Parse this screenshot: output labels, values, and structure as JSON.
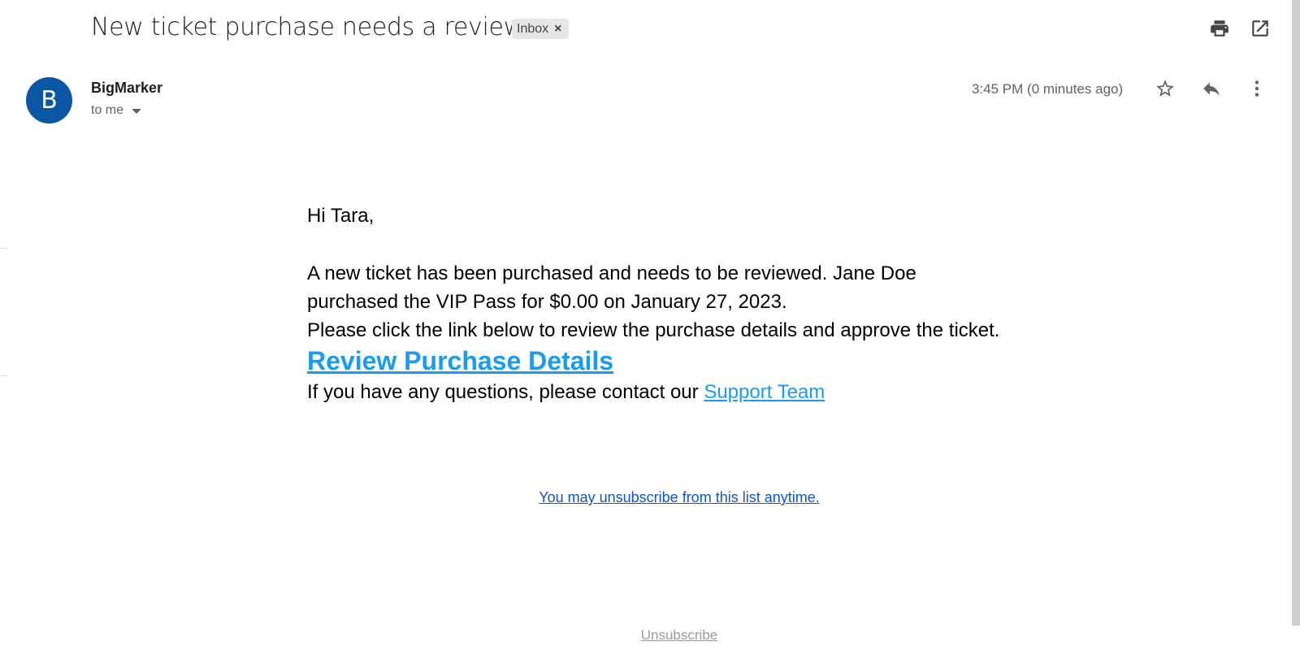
{
  "email": {
    "subject": "New ticket purchase needs a review",
    "label": "Inbox",
    "label_remove": "×",
    "sender": {
      "avatar_letter": "B",
      "avatar_color": "#0b57a4",
      "name": "BigMarker",
      "recipient": "to me"
    },
    "timestamp": "3:45 PM (0 minutes ago)"
  },
  "toolbar": {
    "print_icon": "print-icon",
    "open_new_window_icon": "open-in-new-window-icon",
    "star_icon": "star-icon",
    "reply_icon": "reply-icon",
    "more_icon": "more-vertical-icon"
  },
  "message": {
    "greeting": "Hi Tara,",
    "paragraph_line1": "A new ticket has been purchased and needs to be reviewed. Jane Doe",
    "paragraph_line2": "purchased the VIP Pass for $0.00 on January 27, 2023.",
    "instruction": "Please click the link below to review the purchase details and approve the ticket.",
    "review_link": "Review Purchase Details",
    "questions_text": "If you have any questions, please contact our ",
    "support_link": "Support Team",
    "link_color": "#1a9af0"
  },
  "footer": {
    "unsubscribe_list": "You may unsubscribe from this list anytime.",
    "unsubscribe": "Unsubscribe"
  }
}
